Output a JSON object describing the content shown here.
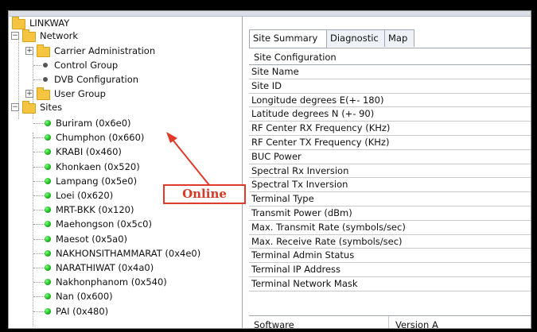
{
  "tree": {
    "root": "LINKWAY",
    "network": {
      "label": "Network",
      "children": [
        "Carrier Administration",
        "Control Group",
        "DVB Configuration",
        "User Group"
      ]
    },
    "sites": {
      "label": "Sites",
      "items": [
        "Buriram (0x6e0)",
        "Chumphon (0x660)",
        "KRABI (0x460)",
        "Khonkaen (0x520)",
        "Lampang (0x5e0)",
        "Loei (0x620)",
        "MRT-BKK (0x120)",
        "Maehongson (0x5c0)",
        "Maesot (0x5a0)",
        "NAKHONSITHAMMARAT (0x4e0)",
        "NARATHIWAT (0x4a0)",
        "Nakhonphanom (0x540)",
        "Nan (0x600)",
        "PAI (0x480)"
      ]
    }
  },
  "tabs": [
    "Site Summary",
    "Diagnostic",
    "Map"
  ],
  "section_header": "Site Configuration",
  "properties": [
    "Site Name",
    "Site ID",
    "Longitude degrees E(+- 180)",
    "Latitude degrees N (+- 90)",
    "RF Center RX Frequency (KHz)",
    "RF Center TX Frequency (KHz)",
    "BUC Power",
    "Spectral Rx Inversion",
    "Spectral Tx Inversion",
    "Terminal Type",
    "Transmit Power (dBm)",
    "Max. Transmit Rate (symbols/sec)",
    "Max. Receive Rate  (symbols/sec)",
    "Terminal Admin Status",
    "Terminal IP Address",
    "Terminal Network  Mask"
  ],
  "software_row": {
    "label": "Software",
    "value": "Version A"
  },
  "annotation": {
    "text": "Online",
    "color": "#d53a25"
  }
}
